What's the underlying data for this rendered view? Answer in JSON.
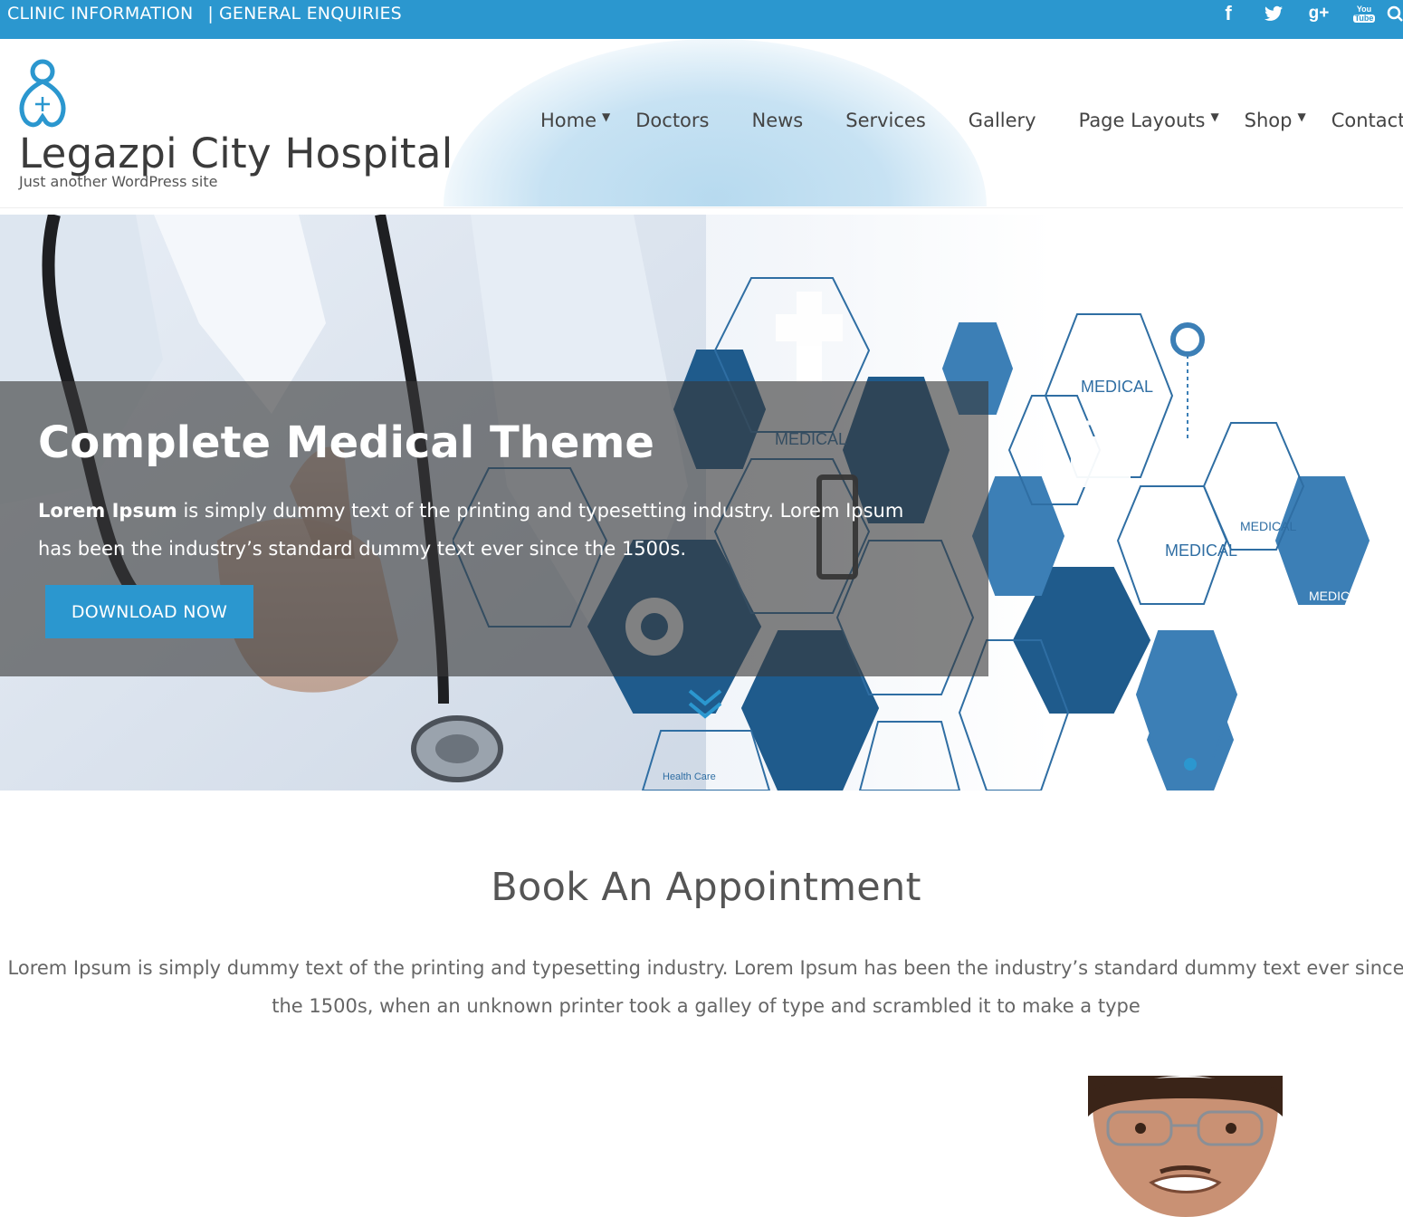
{
  "topbar": {
    "clinic_info": "CLINIC INFORMATION",
    "separator": "|",
    "general_enquiries": "GENERAL ENQUIRIES",
    "social": {
      "facebook": "f",
      "googleplus": "g+",
      "youtube_top": "You",
      "youtube_bottom": "Tube"
    },
    "bar_color": "#2b97cf"
  },
  "header": {
    "site_title": "Legazpi City Hospital",
    "tagline": "Just another WordPress site",
    "nav": [
      {
        "label": "Home",
        "has_dropdown": true
      },
      {
        "label": "Doctors",
        "has_dropdown": false
      },
      {
        "label": "News",
        "has_dropdown": false
      },
      {
        "label": "Services",
        "has_dropdown": false
      },
      {
        "label": "Gallery",
        "has_dropdown": false
      },
      {
        "label": "Page Layouts",
        "has_dropdown": true
      },
      {
        "label": "Shop",
        "has_dropdown": true
      },
      {
        "label": "Contact",
        "has_dropdown": false
      }
    ],
    "caret": "▼"
  },
  "hero": {
    "title": "Complete Medical Theme",
    "text_bold": "Lorem Ipsum",
    "text_rest": " is simply dummy text of the printing and typesetting industry. Lorem Ipsum has been the industry’s standard dummy text ever since the 1500s.",
    "button": "DOWNLOAD NOW",
    "hex_labels": {
      "medical": "MEDICAL",
      "health_care": "Health Care"
    }
  },
  "appointment": {
    "title": "Book An Appointment",
    "text": "Lorem Ipsum is simply dummy text of the printing and typesetting industry. Lorem Ipsum has been the industry’s standard dummy text ever since the 1500s, when an unknown printer took a galley of type and scrambled it to make a type"
  },
  "colors": {
    "accent": "#2b97cf",
    "dark_hex": "#1f5b8c",
    "mid_hex": "#3c7fb6"
  }
}
